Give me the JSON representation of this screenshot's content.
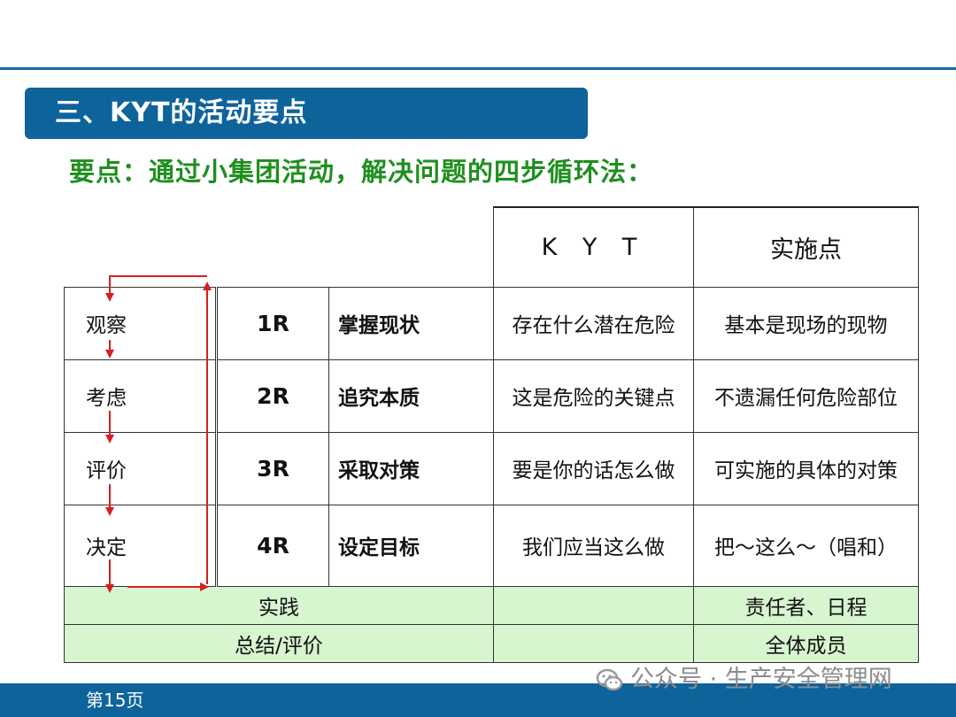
{
  "section": {
    "title": "三、KYT的活动要点"
  },
  "subtitle": "要点：通过小集团活动，解决问题的四步循环法：",
  "table": {
    "headers": {
      "kyt": "K Y T",
      "points": "实施点"
    },
    "rows": [
      {
        "name": "观察",
        "code": "1R",
        "action": "掌握现状",
        "kyt": "存在什么潜在危险",
        "point": "基本是现场的现物"
      },
      {
        "name": "考虑",
        "code": "2R",
        "action": "追究本质",
        "kyt": "这是危险的关键点",
        "point": "不遗漏任何危险部位"
      },
      {
        "name": "评价",
        "code": "3R",
        "action": "采取对策",
        "kyt": "要是你的话怎么做",
        "point": "可实施的具体的对策"
      },
      {
        "name": "决定",
        "code": "4R",
        "action": "设定目标",
        "kyt": "我们应当这么做",
        "point": "把～这么～（唱和）"
      }
    ],
    "footer_rows": [
      {
        "label": "实践",
        "kyt": "",
        "point": "责任者、日程"
      },
      {
        "label": "总结/评价",
        "kyt": "",
        "point": "全体成员"
      }
    ]
  },
  "colors": {
    "brand_blue": "#0e639b",
    "subtitle_green": "#1f8f1f",
    "arrow_red": "#d62020",
    "highlight_green": "#d7f5cf"
  },
  "footer": {
    "page_label": "第15页",
    "watermark": "公众号 · 生产安全管理网",
    "watermark_icon": "wechat-icon"
  }
}
